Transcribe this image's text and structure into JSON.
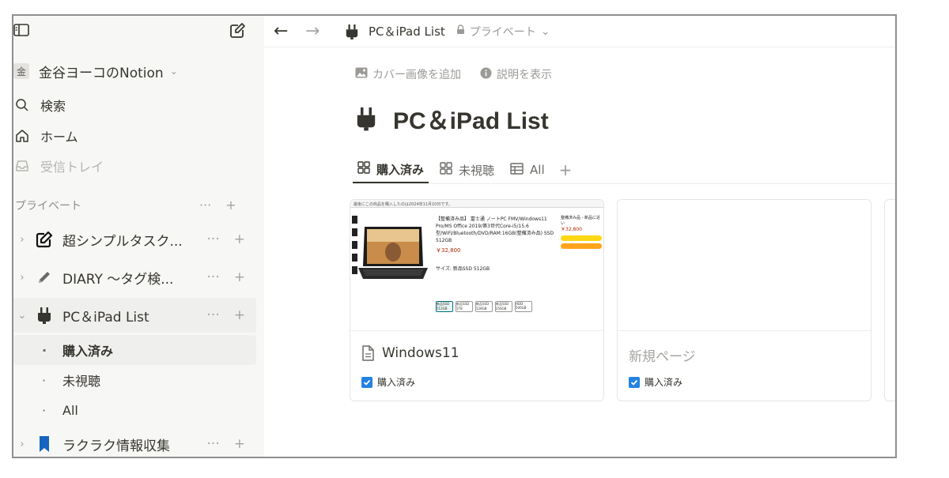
{
  "sidebar": {
    "workspace": {
      "badge": "金",
      "name": "金谷ヨーコのNotion"
    },
    "nav": [
      {
        "label": "検索",
        "icon": "search-icon"
      },
      {
        "label": "ホーム",
        "icon": "home-icon"
      },
      {
        "label": "受信トレイ",
        "icon": "inbox-icon"
      }
    ],
    "section_label": "プライベート",
    "pages": [
      {
        "title": "超シンプルタスク...",
        "icon": "edit-square-icon"
      },
      {
        "title": "DIARY 〜タグ検...",
        "icon": "pencil-icon"
      },
      {
        "title": "PC＆iPad List",
        "icon": "plug-icon"
      },
      {
        "title": "ラクラク情報収集",
        "icon": "bookmark-icon"
      }
    ],
    "sub_pages": [
      {
        "title": "購入済み"
      },
      {
        "title": "未視聴"
      },
      {
        "title": "All"
      }
    ],
    "dots_label": "···",
    "plus_label": "+"
  },
  "topbar": {
    "back": "←",
    "forward": "→",
    "breadcrumb_title": "PC＆iPad List",
    "privacy": "プライベート"
  },
  "page": {
    "add_cover": "カバー画像を追加",
    "show_description": "説明を表示",
    "title": "PC＆iPad List",
    "tabs": [
      {
        "label": "購入済み",
        "icon": "gallery-icon"
      },
      {
        "label": "未視聴",
        "icon": "gallery-icon"
      },
      {
        "label": "All",
        "icon": "table-icon"
      }
    ],
    "tab_add": "+"
  },
  "cards": [
    {
      "title": "Windows11",
      "property": "購入済み",
      "cover": {
        "banner": "最後にこの商品を購入したのは2024年11月10日です。",
        "product_title": "【整備済み品】 富士通 ノートPC FMV/Windows11 Pro/MS Office 2019/第3世代Core-i5/15.6型/WiFi/Bluetooth/DVD/RAM:16GB(整備済み品) SSD 512GB",
        "price": "￥32,800",
        "size_label": "サイズ: 新品SSD 512GB",
        "sizes": [
          "新品SSD 512GB",
          "新品SSD 1TB",
          "新品SSD 128GB",
          "新品SSD 256GB",
          "HDD 500GB"
        ],
        "buy_box_title": "整備済み品 - 新品に近い",
        "buy_box_price": "￥32,800"
      }
    },
    {
      "title": "新規ページ",
      "property": "購入済み"
    }
  ],
  "colors": {
    "sidebar_bg": "#f7f7f5",
    "accent_blue": "#2383e2",
    "text": "#37352f",
    "muted": "#9b9a97"
  }
}
